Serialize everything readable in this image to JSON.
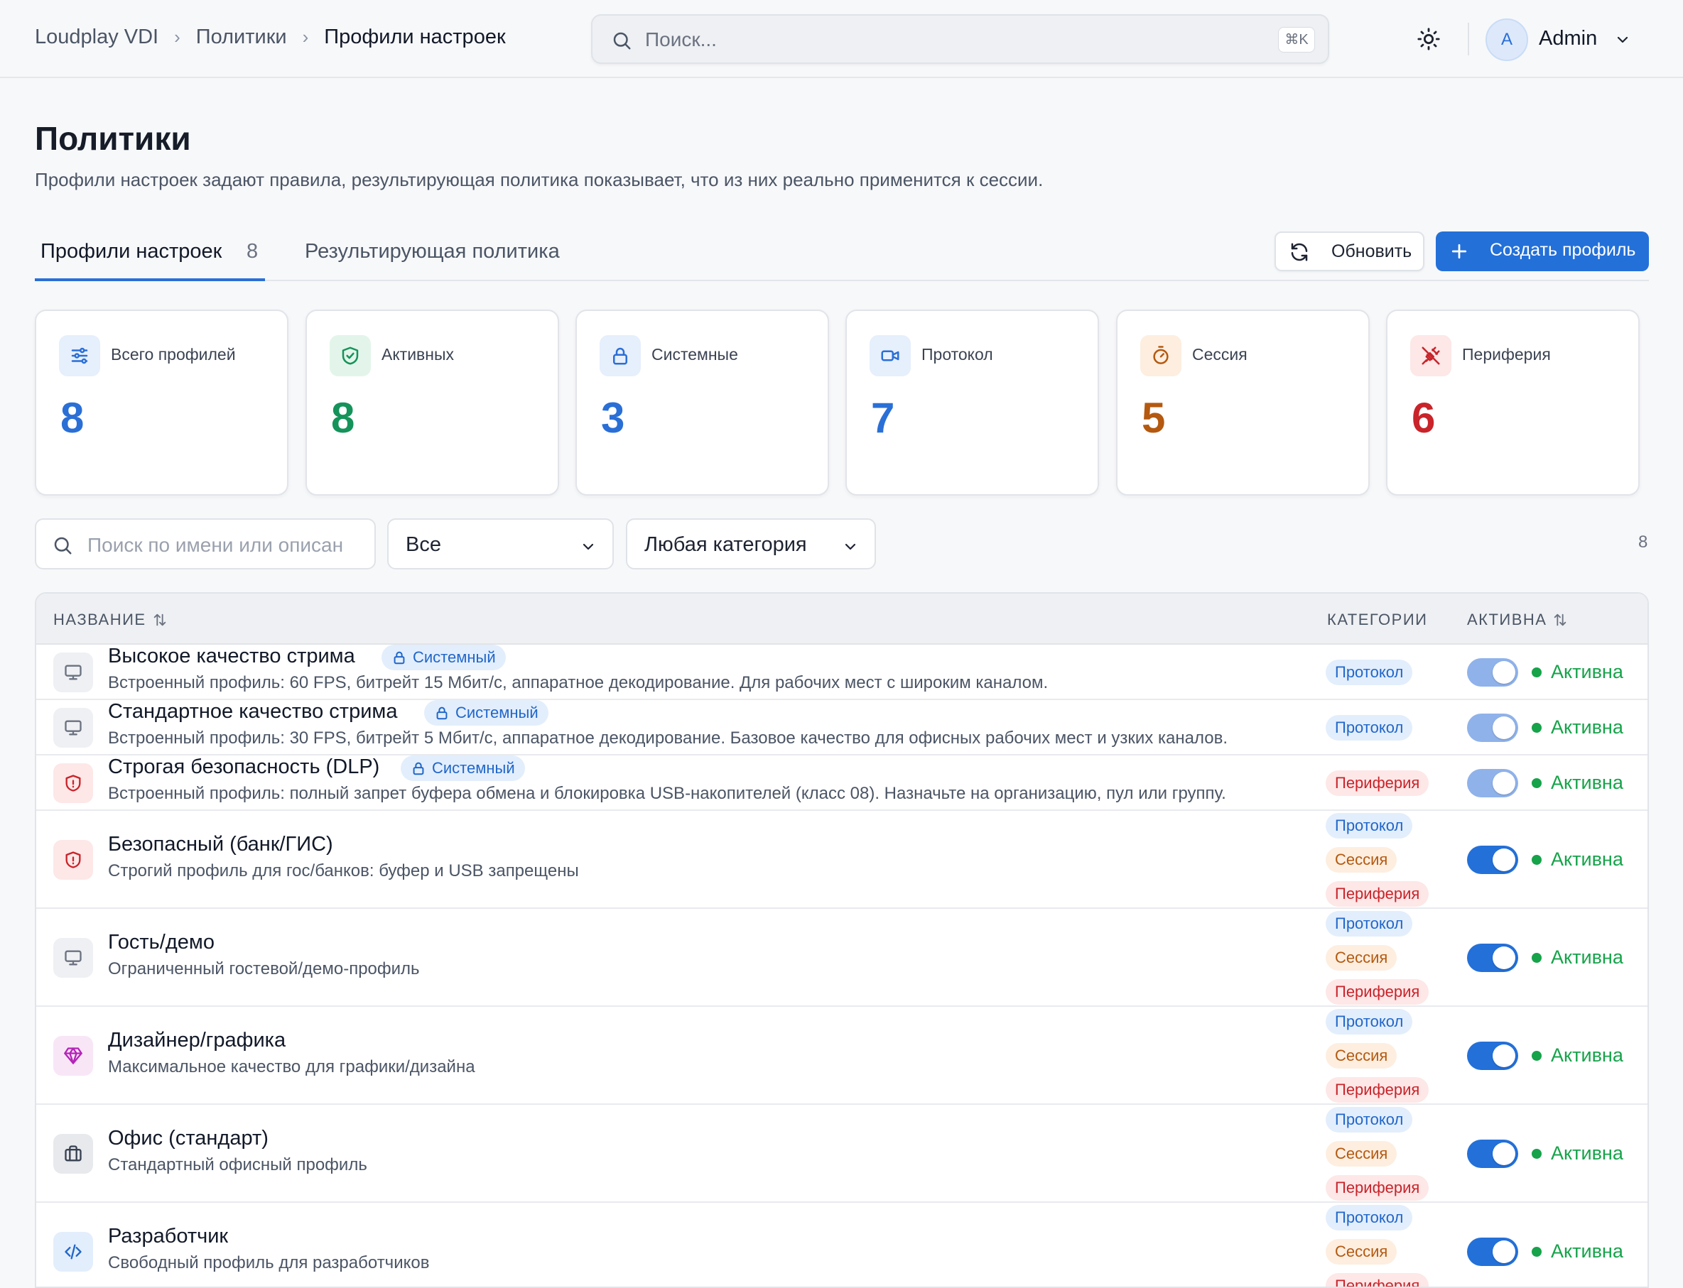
{
  "breadcrumbs": [
    "Loudplay VDI",
    "Политики",
    "Профили настроек"
  ],
  "search": {
    "placeholder": "Поиск...",
    "shortcut": "⌘K"
  },
  "user": {
    "initial": "A",
    "name": "Admin"
  },
  "page": {
    "title": "Политики",
    "subtitle": "Профили настроек задают правила, результирующая политика показывает, что из них реально применится к сессии."
  },
  "tabs": [
    {
      "label": "Профили настроек",
      "count": "8"
    },
    {
      "label": "Результирующая политика"
    }
  ],
  "actions": {
    "refresh": "Обновить",
    "create": "Создать профиль"
  },
  "stats": [
    {
      "label": "Всего профилей",
      "value": "8",
      "icon": "sliders-icon",
      "color": "#2a6fd6",
      "bg": "#e6effc"
    },
    {
      "label": "Активных",
      "value": "8",
      "icon": "shield-check-icon",
      "color": "#15935a",
      "bg": "#e3f5ea"
    },
    {
      "label": "Системные",
      "value": "3",
      "icon": "lock-icon",
      "color": "#2a6fd6",
      "bg": "#e6effc"
    },
    {
      "label": "Протокол",
      "value": "7",
      "icon": "video-icon",
      "color": "#2a6fd6",
      "bg": "#e6effc"
    },
    {
      "label": "Сессия",
      "value": "5",
      "icon": "timer-icon",
      "color": "#b4590f",
      "bg": "#fdeee0"
    },
    {
      "label": "Периферия",
      "value": "6",
      "icon": "plug-off-icon",
      "color": "#c8242a",
      "bg": "#fde7e7"
    }
  ],
  "filters": {
    "search_placeholder": "Поиск по имени или описан",
    "status": "Все",
    "category": "Любая категория",
    "count": "8"
  },
  "table": {
    "columns": {
      "name": "НАЗВАНИЕ",
      "categories": "КАТЕГОРИИ",
      "active": "АКТИВНА"
    },
    "system_label": "Системный",
    "rows": [
      {
        "name": "Высокое качество стрима",
        "system": true,
        "desc": "Встроенный профиль: 60 FPS, битрейт 15 Мбит/с, аппаратное декодирование. Для рабочих мест с широким каналом.",
        "icon": "monitor-icon",
        "categories": [
          "Протокол"
        ],
        "status": "Активна"
      },
      {
        "name": "Стандартное качество стрима",
        "system": true,
        "desc": "Встроенный профиль: 30 FPS, битрейт 5 Мбит/с, аппаратное декодирование. Базовое качество для офисных рабочих мест и узких каналов.",
        "icon": "monitor-icon",
        "categories": [
          "Протокол"
        ],
        "status": "Активна"
      },
      {
        "name": "Строгая безопасность (DLP)",
        "system": true,
        "desc": "Встроенный профиль: полный запрет буфера обмена и блокировка USB-накопителей (класс 08). Назначьте на организацию, пул или группу.",
        "icon": "shield-icon",
        "categories": [
          "Периферия"
        ],
        "status": "Активна"
      },
      {
        "name": "Безопасный (банк/ГИС)",
        "system": false,
        "desc": "Строгий профиль для гос/банков: буфер и USB запрещены",
        "icon": "shield-icon",
        "categories": [
          "Протокол",
          "Сессия",
          "Периферия"
        ],
        "status": "Активна"
      },
      {
        "name": "Гость/демо",
        "system": false,
        "desc": "Ограниченный гостевой/демо-профиль",
        "icon": "monitor-icon",
        "categories": [
          "Протокол",
          "Сессия",
          "Периферия"
        ],
        "status": "Активна"
      },
      {
        "name": "Дизайнер/графика",
        "system": false,
        "desc": "Максимальное качество для графики/дизайна",
        "icon": "gem-icon",
        "categories": [
          "Протокол",
          "Сессия",
          "Периферия"
        ],
        "status": "Активна"
      },
      {
        "name": "Офис (стандарт)",
        "system": false,
        "desc": "Стандартный офисный профиль",
        "icon": "briefcase-icon",
        "categories": [
          "Протокол",
          "Сессия",
          "Периферия"
        ],
        "status": "Активна"
      },
      {
        "name": "Разработчик",
        "system": false,
        "desc": "Свободный профиль для разработчиков",
        "icon": "code-icon",
        "categories": [
          "Протокол",
          "Сессия",
          "Периферия"
        ],
        "status": "Активна"
      }
    ]
  }
}
